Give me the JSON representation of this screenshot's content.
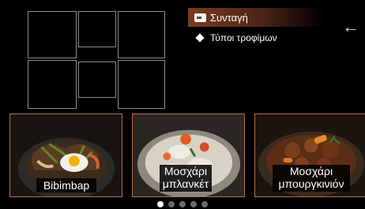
{
  "menu": {
    "items": [
      {
        "label": "Συνταγή",
        "icon": "recipe-icon",
        "active": true
      },
      {
        "label": "Τύποι τροφίμων",
        "icon": "diamond-icon",
        "active": false
      }
    ]
  },
  "back": {
    "icon": "back-arrow-icon"
  },
  "cards": [
    {
      "label": "Bibimbap"
    },
    {
      "label": "Μοσχάρι μπλανκέτ"
    },
    {
      "label": "Μοσχάρι μπουργκινιόν"
    }
  ],
  "pagination": {
    "total": 5,
    "current": 1
  },
  "colors": {
    "accent": "#b37052",
    "active_menu": "#7a3a22"
  }
}
